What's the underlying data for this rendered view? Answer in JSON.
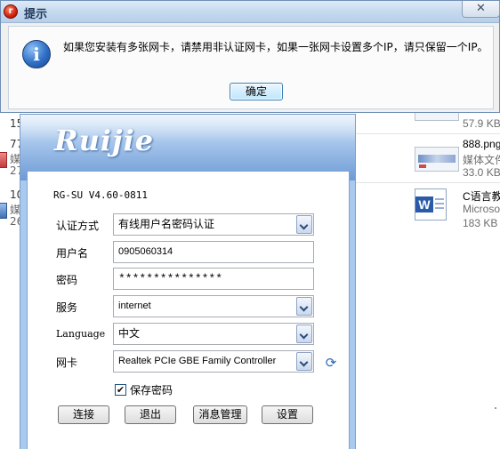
{
  "message_box": {
    "title": "提示",
    "app_icon_glyph": "r",
    "close_glyph": "✕",
    "text": "如果您安装有多张网卡，请禁用非认证网卡，如果一张网卡设置多个IP，请只保留一个IP。",
    "info_glyph": "i",
    "ok_label": "确定"
  },
  "explorer": {
    "left_items": [
      {
        "line1": "15",
        "line2": "",
        "line3": ""
      },
      {
        "line1": "77",
        "line2": "媒",
        "line3": "27"
      },
      {
        "line1": "10",
        "line2": "媒",
        "line3": "26"
      }
    ],
    "files": [
      {
        "name": "",
        "type": "",
        "size": "57.9 KB"
      },
      {
        "name": "888.png",
        "type": "媒体文件",
        "size": "33.0 KB"
      },
      {
        "name": "C语言教",
        "type": "Microso",
        "size": "183 KB"
      }
    ],
    "word_glyph": "W"
  },
  "client": {
    "logo": "Ruijie",
    "version": "RG-SU V4.60-0811",
    "auth_mode_label": "认证方式",
    "auth_mode_value": "有线用户名密码认证",
    "username_label": "用户名",
    "username_value": "0905060314",
    "password_label": "密码",
    "password_value": "***************",
    "service_label": "服务",
    "service_value": "internet",
    "language_label": "Language",
    "language_value": "中文",
    "nic_label": "网卡",
    "nic_value": "Realtek PCIe GBE Family Controller",
    "refresh_glyph": "⟳",
    "save_password_label": "保存密码",
    "save_password_checked": true,
    "check_glyph": "✔",
    "buttons": {
      "connect": "连接",
      "exit": "退出",
      "messages": "消息管理",
      "settings": "设置"
    }
  }
}
